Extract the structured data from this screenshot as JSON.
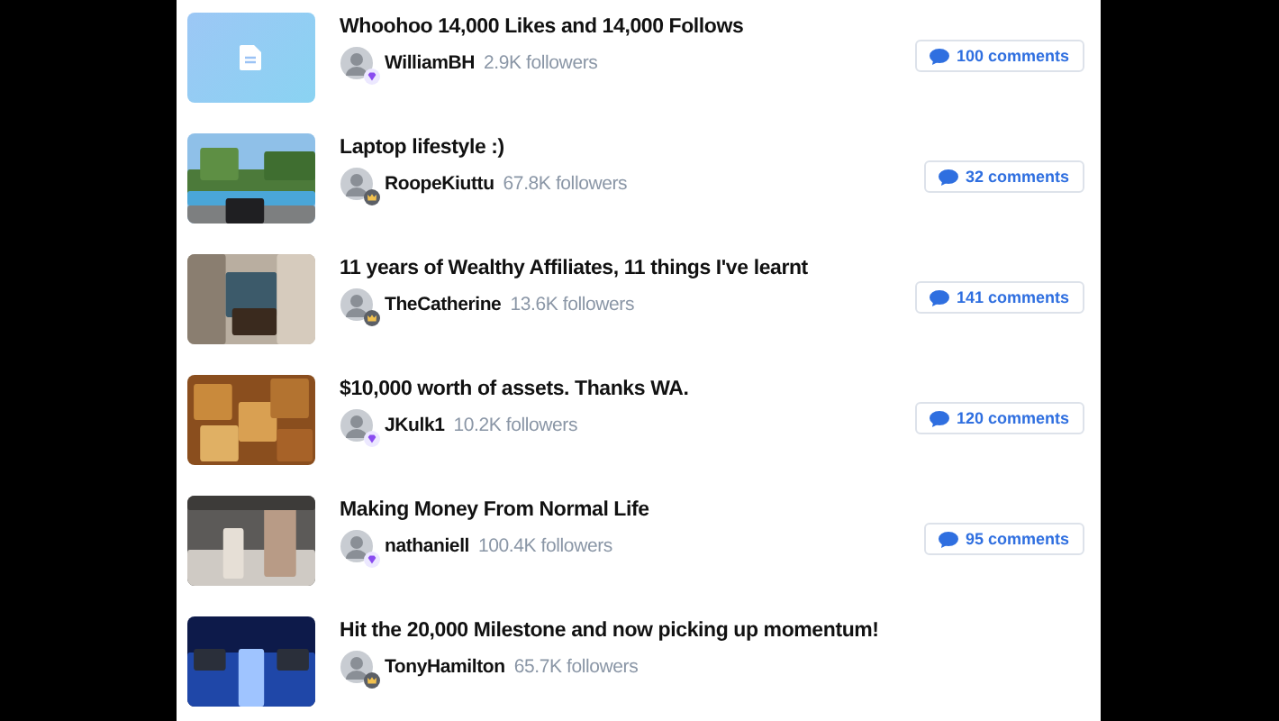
{
  "posts": [
    {
      "thumbnail": {
        "kind": "document"
      },
      "title": "Whoohoo 14,000 Likes and 14,000 Follows",
      "author": "WilliamBH",
      "followers": "2.9K followers",
      "badge": {
        "kind": "diamond"
      },
      "comments": "100 comments"
    },
    {
      "thumbnail": {
        "kind": "pool"
      },
      "title": "Laptop lifestyle :)",
      "author": "RoopeKiuttu",
      "followers": "67.8K followers",
      "badge": {
        "kind": "crown"
      },
      "comments": "32 comments"
    },
    {
      "thumbnail": {
        "kind": "boots"
      },
      "title": "11 years of Wealthy Affiliates, 11 things I've learnt",
      "author": "TheCatherine",
      "followers": "13.6K followers",
      "badge": {
        "kind": "crown"
      },
      "comments": "141 comments"
    },
    {
      "thumbnail": {
        "kind": "coins"
      },
      "title": "$10,000 worth of assets. Thanks WA.",
      "author": "JKulk1",
      "followers": "10.2K followers",
      "badge": {
        "kind": "diamond"
      },
      "comments": "120 comments"
    },
    {
      "thumbnail": {
        "kind": "kitchen"
      },
      "title": "Making Money From Normal Life",
      "author": "nathaniell",
      "followers": "100.4K followers",
      "badge": {
        "kind": "diamond"
      },
      "comments": "95 comments"
    },
    {
      "thumbnail": {
        "kind": "screens"
      },
      "title": "Hit the 20,000 Milestone and now picking up momentum!",
      "author": "TonyHamilton",
      "followers": "65.7K followers",
      "badge": {
        "kind": "crown"
      }
    }
  ]
}
